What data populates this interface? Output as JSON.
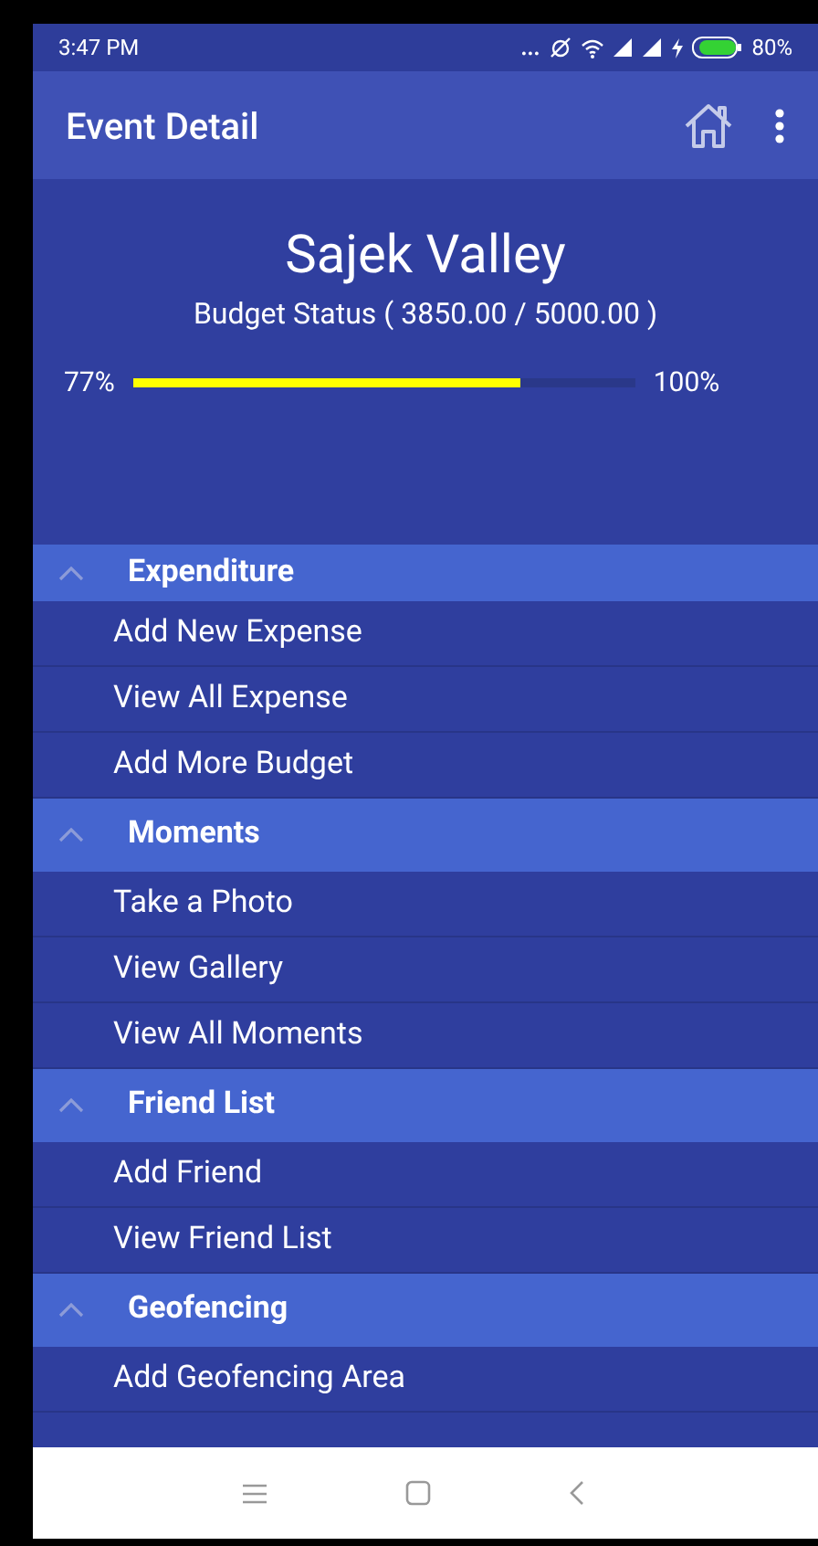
{
  "status_bar": {
    "time": "3:47 PM",
    "dots": "...",
    "battery": "80%"
  },
  "app_bar": {
    "title": "Event Detail"
  },
  "event": {
    "name": "Sajek Valley",
    "budget_status": "Budget Status ( 3850.00 / 5000.00 )",
    "progress": {
      "level": 0.77,
      "reading": "77%",
      "max_label": "100%"
    }
  },
  "sections": [
    {
      "title": "Expenditure",
      "expanded": true,
      "items": [
        "Add New Expense",
        "View All Expense",
        "Add More Budget"
      ]
    },
    {
      "title": "Moments",
      "expanded": true,
      "items": [
        "Take a Photo",
        "View Gallery",
        "View All Moments"
      ]
    },
    {
      "title": "Friend List",
      "expanded": true,
      "items": [
        "Add Friend",
        "View Friend List"
      ]
    },
    {
      "title": "Geofencing",
      "expanded": true,
      "items": [
        "Add Geofencing Area"
      ]
    }
  ]
}
